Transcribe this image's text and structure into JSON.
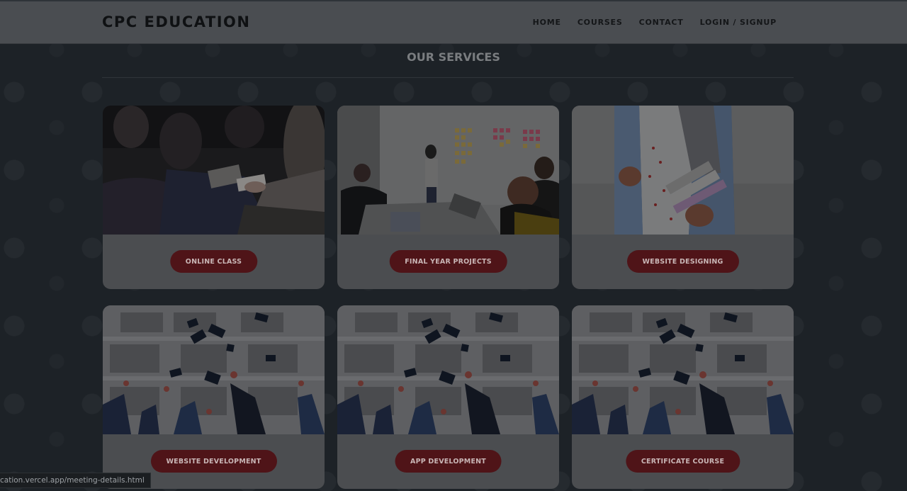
{
  "header": {
    "brand": "CPC EDUCATION",
    "nav": [
      "HOME",
      "COURSES",
      "CONTACT",
      "LOGIN / SIGNUP"
    ]
  },
  "services": {
    "title": "OUR SERVICES",
    "cards": [
      {
        "label": "ONLINE CLASS",
        "image": "students-writing-photo"
      },
      {
        "label": "FINAL YEAR PROJECTS",
        "image": "team-meeting-photo"
      },
      {
        "label": "WEBSITE DESIGNING",
        "image": "student-holding-books-photo"
      },
      {
        "label": "WEBSITE DEVELOPMENT",
        "image": "graduation-caps-photo"
      },
      {
        "label": "APP DEVELOPMENT",
        "image": "graduation-caps-photo"
      },
      {
        "label": "CERTIFICATE COURSE",
        "image": "graduation-caps-photo"
      }
    ]
  },
  "status_bar": {
    "url": "cation.vercel.app/meeting-details.html"
  },
  "colors": {
    "header_bg": "#4a4d51",
    "page_bg": "#1d2227",
    "card_bg": "#4b4d50",
    "button_bg": "#4f1418"
  }
}
